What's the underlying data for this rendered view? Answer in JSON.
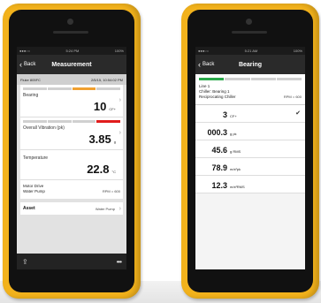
{
  "left_screen": {
    "status": {
      "left": "●●●○○",
      "time": "5:24 PM",
      "right": "100%"
    },
    "nav": {
      "back": "Back",
      "title": "Measurement"
    },
    "device": {
      "name": "Fluke 805FC",
      "datetime": "2/5/15, 10:54:02 PM"
    },
    "measurements": [
      {
        "label": "Bearing",
        "value": "10",
        "unit": "CF+",
        "segments": [
          "#d0d0d0",
          "#d0d0d0",
          "#f0a030",
          "#d0d0d0"
        ]
      },
      {
        "label": "Overall Vibration (pk)",
        "value": "3.85",
        "unit": "g",
        "segments": [
          "#d0d0d0",
          "#d0d0d0",
          "#d0d0d0",
          "#e01c1c"
        ]
      },
      {
        "label": "Temperature",
        "value": "22.8",
        "unit": "°C"
      }
    ],
    "location": {
      "line1": "Motor Drive",
      "line2": "Water Pump",
      "rpm": "RPM = 600"
    },
    "asset": {
      "label": "Asset",
      "value": "Water Pump"
    },
    "toolbar": {
      "share_icon": "⇪",
      "more_icon": "•••"
    }
  },
  "right_screen": {
    "status": {
      "left": "●●●○○",
      "time": "5:21 AM",
      "right": "100%"
    },
    "nav": {
      "back": "Back",
      "title": "Bearing"
    },
    "header": {
      "line1": "Line 1",
      "line2": "Chiller: Bearing 1",
      "line3": "Reciprocating Chiller",
      "rpm": "RPM = 600"
    },
    "bar_segments": [
      "#2aa84a",
      "#d0d0d0",
      "#d0d0d0",
      "#d0d0d0"
    ],
    "units": [
      {
        "value": "3",
        "unit": "CF+",
        "selected": true
      },
      {
        "value": "000.3",
        "unit": "g pk",
        "selected": false
      },
      {
        "value": "45.6",
        "unit": "g RMS",
        "selected": false
      },
      {
        "value": "78.9",
        "unit": "m/s²pk",
        "selected": false
      },
      {
        "value": "12.3",
        "unit": "m/s²RMS",
        "selected": false
      }
    ],
    "check_icon": "✔"
  }
}
